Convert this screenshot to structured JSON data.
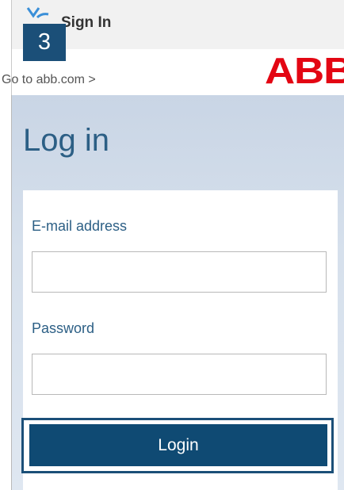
{
  "window": {
    "title": "Sign In",
    "logo_icon": "abb-app-logo-icon"
  },
  "step_badge": "3",
  "header": {
    "goto_link": "Go to abb.com >",
    "brand_logo": "ABB"
  },
  "login": {
    "heading": "Log in",
    "email": {
      "label": "E-mail address",
      "value": "",
      "placeholder": ""
    },
    "password": {
      "label": "Password",
      "value": "",
      "placeholder": ""
    },
    "submit_label": "Login"
  },
  "colors": {
    "brand_red": "#e30613",
    "primary_blue": "#0f4a73",
    "heading_blue": "#2c5f85",
    "badge_blue": "#1b4f78"
  }
}
